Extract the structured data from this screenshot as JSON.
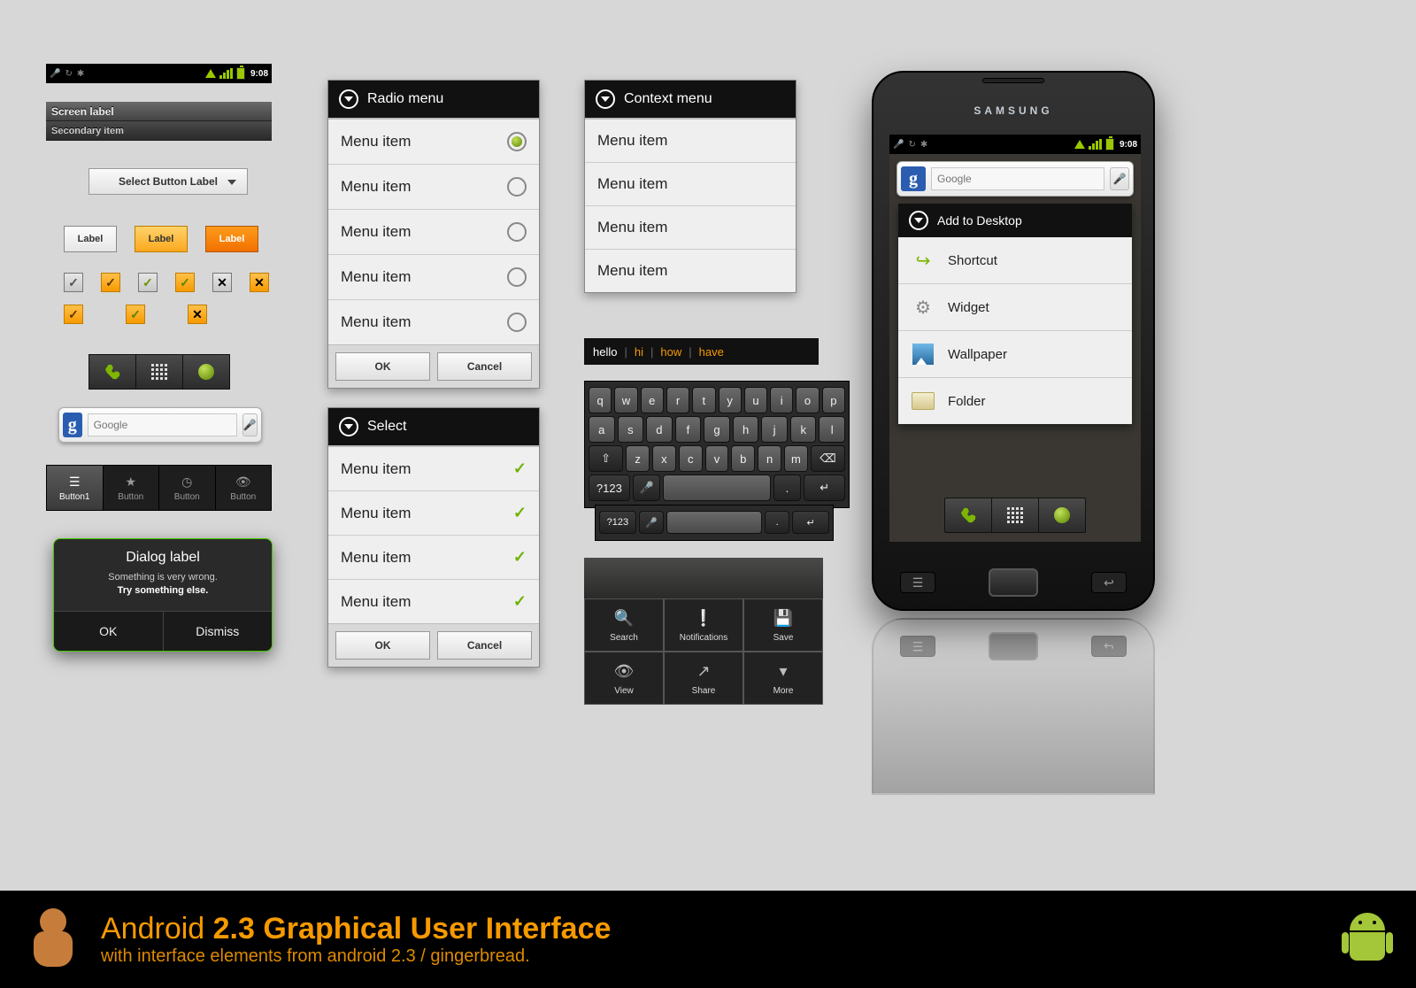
{
  "statusbar": {
    "time": "9:08"
  },
  "screen_label": {
    "primary": "Screen label",
    "secondary": "Secondary item"
  },
  "spinner_label": "Select Button Label",
  "label_buttons": [
    "Label",
    "Label",
    "Label"
  ],
  "search": {
    "placeholder": "Google"
  },
  "tabbar": [
    "Button1",
    "Button",
    "Button",
    "Button"
  ],
  "dialog": {
    "title": "Dialog label",
    "line1": "Something is very wrong.",
    "line2": "Try something else.",
    "ok": "OK",
    "dismiss": "Dismiss"
  },
  "radio_menu": {
    "title": "Radio menu",
    "items": [
      "Menu item",
      "Menu item",
      "Menu item",
      "Menu item",
      "Menu item"
    ],
    "ok": "OK",
    "cancel": "Cancel"
  },
  "select_menu": {
    "title": "Select",
    "items": [
      "Menu item",
      "Menu item",
      "Menu item",
      "Menu item"
    ],
    "ok": "OK",
    "cancel": "Cancel"
  },
  "context_menu": {
    "title": "Context menu",
    "items": [
      "Menu item",
      "Menu item",
      "Menu item",
      "Menu item"
    ]
  },
  "suggest": [
    "hello",
    "hi",
    "how",
    "have"
  ],
  "keyboard": {
    "row1": [
      "q",
      "w",
      "e",
      "r",
      "t",
      "y",
      "u",
      "i",
      "o",
      "p"
    ],
    "row2": [
      "a",
      "s",
      "d",
      "f",
      "g",
      "h",
      "j",
      "k",
      "l"
    ],
    "row3": [
      "⇧",
      "z",
      "x",
      "c",
      "v",
      "b",
      "n",
      "m",
      "⌫"
    ],
    "row4": [
      "?123",
      "🎤",
      "␣",
      ".",
      "↵"
    ]
  },
  "menugrid": [
    {
      "label": "Search",
      "icon": "🔍"
    },
    {
      "label": "Notifications",
      "icon": "❕"
    },
    {
      "label": "Save",
      "icon": "💾"
    },
    {
      "label": "View",
      "icon": "👁"
    },
    {
      "label": "Share",
      "icon": "↗"
    },
    {
      "label": "More",
      "icon": "▾"
    }
  ],
  "phone": {
    "brand": "SAMSUNG",
    "add_menu": {
      "title": "Add to Desktop",
      "items": [
        "Shortcut",
        "Widget",
        "Wallpaper",
        "Folder"
      ]
    }
  },
  "footer": {
    "line1_a": "Android ",
    "line1_b": "2.3 Graphical User Interface",
    "line2": "with interface elements from android 2.3 / gingerbread."
  }
}
